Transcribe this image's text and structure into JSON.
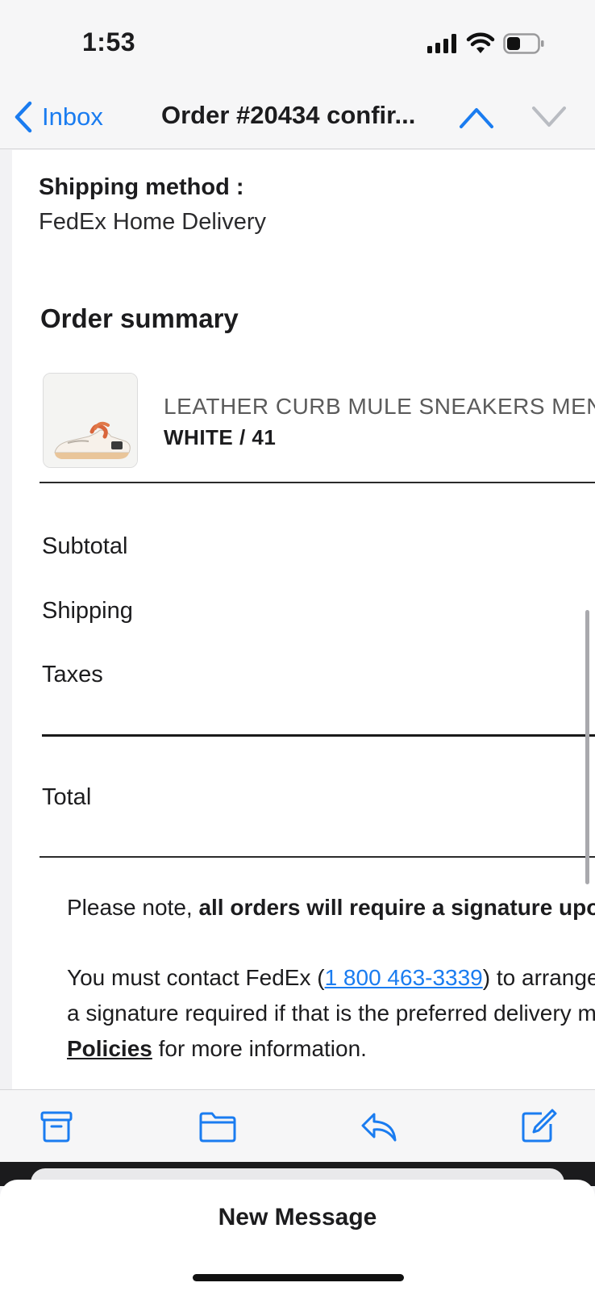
{
  "status_bar": {
    "time": "1:53"
  },
  "nav": {
    "back_label": "Inbox",
    "title": "Order #20434 confir..."
  },
  "email": {
    "shipping_method_label": "Shipping method :",
    "shipping_method_value": "FedEx Home Delivery",
    "order_summary_title": "Order summary",
    "product": {
      "name": "LEATHER CURB MULE SNEAKERS MEN",
      "variant": "WHITE / 41"
    },
    "totals": {
      "subtotal_label": "Subtotal",
      "shipping_label": "Shipping",
      "taxes_label": "Taxes",
      "total_label": "Total"
    },
    "note": {
      "line1_prefix": "Please note, ",
      "line1_bold": "all orders will require a signature upon delivery",
      "line2_prefix": "You must contact FedEx (",
      "phone": "1 800 463-3339",
      "line2_suffix": ") to arrange delivery without",
      "line3": "a signature required if that is the preferred delivery method. See",
      "policies_link": "Policies",
      "line4_suffix": " for more information."
    }
  },
  "toolbar": {
    "icons": [
      "archive-icon",
      "folder-icon",
      "reply-icon",
      "compose-icon"
    ]
  },
  "sheet": {
    "title": "New Message"
  },
  "colors": {
    "accent": "#1a7cf0",
    "background": "#ffffff",
    "chrome": "#f6f6f7"
  }
}
